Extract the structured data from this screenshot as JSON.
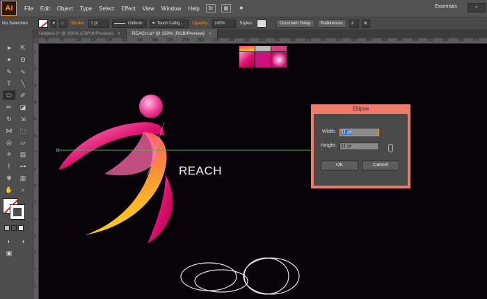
{
  "app": {
    "logo": "Ai"
  },
  "menu": [
    "File",
    "Edit",
    "Object",
    "Type",
    "Select",
    "Effect",
    "View",
    "Window",
    "Help"
  ],
  "menu_icons": {
    "bridge": "Br",
    "stock": "St"
  },
  "workspace": "Essentials",
  "search_placeholder": "",
  "control": {
    "selection": "No Selection",
    "stroke_label": "Stroke:",
    "stroke_value": "1 pt",
    "profile": "Uniform",
    "brush": "Touch Callig...",
    "opacity_label": "Opacity:",
    "opacity_value": "100%",
    "styles_label": "Styles:",
    "doc_setup": "Document Setup",
    "preferences": "Preferences"
  },
  "tabs": [
    {
      "label": "Untitled-1* @ 200% (CMYK/Preview)",
      "active": false
    },
    {
      "label": "REACH.ai* @ 150% (RGB/Preview)",
      "active": true
    }
  ],
  "ruler_top": [
    "72",
    "90",
    "108",
    "126",
    "144",
    "162",
    "180",
    "198",
    "216",
    "234",
    "252",
    "270",
    "288",
    "306",
    "324",
    "342",
    "360",
    "378",
    "396",
    "414",
    "432",
    "450",
    "468",
    "486",
    "504",
    "522",
    "540",
    "558",
    "576"
  ],
  "ruler_left": [
    "1",
    "2",
    "3",
    "4",
    "5",
    "6",
    "7",
    "8",
    "9",
    "1",
    "1",
    "1",
    "1",
    "1",
    "1"
  ],
  "artwork": {
    "text": "REACH"
  },
  "dialog": {
    "title": "Ellipse",
    "width_label": "Width:",
    "width_value": "11 pt",
    "height_label": "Height:",
    "height_value": "11 pt",
    "ok": "OK",
    "cancel": "Cancel"
  },
  "colors": {
    "accent": "#f7931e",
    "dialog_frame": "#f07a6a",
    "magenta": "#e0106f"
  }
}
